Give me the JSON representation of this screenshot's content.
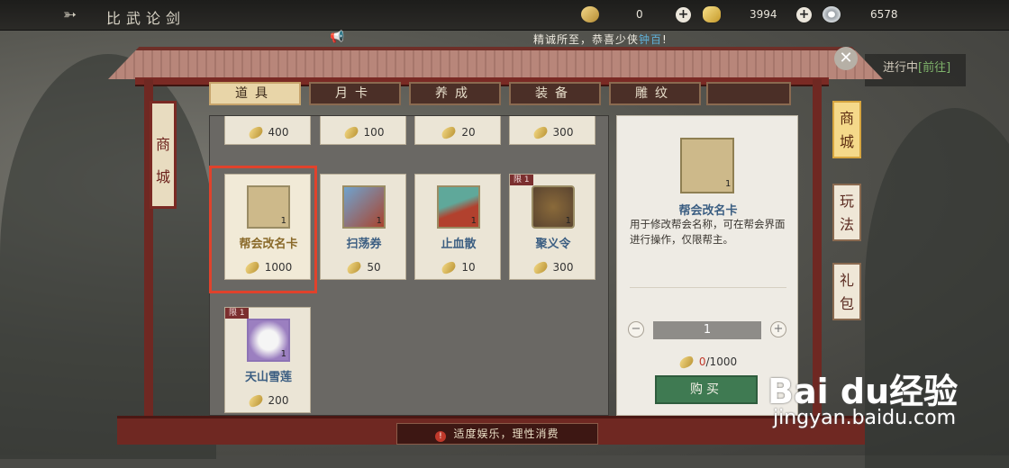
{
  "header": {
    "title": "比武论剑",
    "currencies": [
      {
        "icon": "gold-leaf-icon",
        "value": "0"
      },
      {
        "icon": "gold-ingot-icon",
        "value": "3994"
      },
      {
        "icon": "silver-coin-icon",
        "value": "6578"
      }
    ]
  },
  "notice": {
    "prefix": "精诚所至，恭喜少侠",
    "name": "钟百",
    "suffix": "!"
  },
  "quest": {
    "label": "进行中",
    "link": "[前往]"
  },
  "tabs": [
    {
      "label": "道具",
      "active": true
    },
    {
      "label": "月卡",
      "active": false
    },
    {
      "label": "养成",
      "active": false
    },
    {
      "label": "装备",
      "active": false
    },
    {
      "label": "雕纹",
      "active": false
    }
  ],
  "left_banner": "商城",
  "side_tabs": [
    {
      "label": "商城",
      "active": true
    },
    {
      "label": "玩法",
      "active": false
    },
    {
      "label": "礼包",
      "active": false
    }
  ],
  "items_top_row": [
    {
      "price": "400"
    },
    {
      "price": "100"
    },
    {
      "price": "20"
    },
    {
      "price": "300"
    }
  ],
  "items": [
    {
      "name": "帮会改名卡",
      "qty": "1",
      "price": "1000",
      "limit": "",
      "selected": true,
      "icon": "rename-card-icon"
    },
    {
      "name": "扫荡券",
      "qty": "1",
      "price": "50",
      "limit": "",
      "selected": false,
      "icon": "sweep-ticket-icon"
    },
    {
      "name": "止血散",
      "qty": "1",
      "price": "10",
      "limit": "",
      "selected": false,
      "icon": "medicine-powder-icon"
    },
    {
      "name": "聚义令",
      "qty": "1",
      "price": "300",
      "limit": "限 1",
      "selected": false,
      "icon": "token-icon"
    },
    {
      "name": "天山雪莲",
      "qty": "1",
      "price": "200",
      "limit": "限 1",
      "selected": false,
      "icon": "snow-lotus-icon"
    }
  ],
  "detail": {
    "name": "帮会改名卡",
    "qty": "1",
    "description": "用于修改帮会名称，可在帮会界面进行操作，仅限帮主。",
    "quantity": "1",
    "owned": "0",
    "price": "/1000",
    "buy_label": "购买"
  },
  "footer": {
    "text": "适度娱乐，理性消费",
    "icon": "!"
  },
  "watermark": {
    "brand": "Bai du经验",
    "url": "jingyan.baidu.com"
  },
  "colors": {
    "accent": "#e0422c",
    "frame": "#6f2822",
    "buy": "#3f7a52"
  }
}
